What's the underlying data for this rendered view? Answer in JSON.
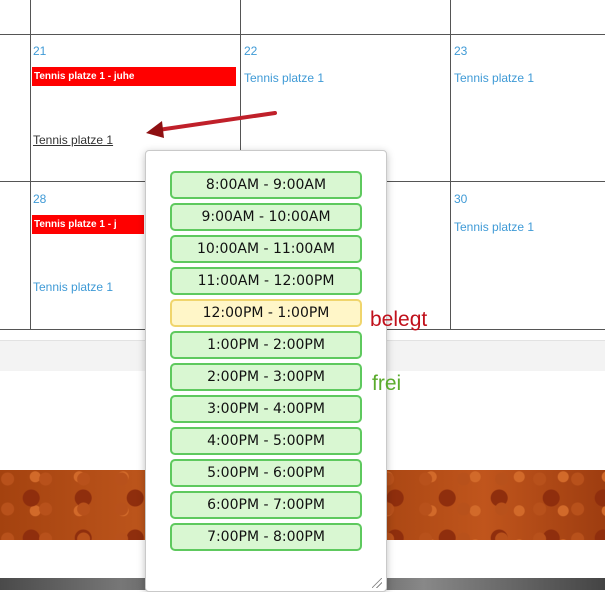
{
  "calendar": {
    "week1": {
      "day21": {
        "number": "21",
        "event_red": "Tennis platze 1 - juhe",
        "event_link": "Tennis platze 1"
      },
      "day22": {
        "number": "22",
        "event_link": "Tennis platze 1"
      },
      "day23": {
        "number": "23",
        "event_link": "Tennis platze 1"
      }
    },
    "week2": {
      "day28": {
        "number": "28",
        "event_red": "Tennis platze 1 - j",
        "event_link": "Tennis platze 1"
      },
      "day30": {
        "number": "30",
        "event_link": "Tennis platze 1"
      }
    }
  },
  "popup": {
    "slots": [
      {
        "label": "8:00AM - 9:00AM",
        "status": "free"
      },
      {
        "label": "9:00AM - 10:00AM",
        "status": "free"
      },
      {
        "label": "10:00AM - 11:00AM",
        "status": "free"
      },
      {
        "label": "11:00AM - 12:00PM",
        "status": "free"
      },
      {
        "label": "12:00PM - 1:00PM",
        "status": "busy"
      },
      {
        "label": "1:00PM - 2:00PM",
        "status": "free"
      },
      {
        "label": "2:00PM - 3:00PM",
        "status": "free"
      },
      {
        "label": "3:00PM - 4:00PM",
        "status": "free"
      },
      {
        "label": "4:00PM - 5:00PM",
        "status": "free"
      },
      {
        "label": "5:00PM - 6:00PM",
        "status": "free"
      },
      {
        "label": "6:00PM - 7:00PM",
        "status": "free"
      },
      {
        "label": "7:00PM - 8:00PM",
        "status": "free"
      }
    ]
  },
  "legend": {
    "busy": "belegt",
    "free": "frei"
  },
  "colors": {
    "free_bg": "#d9f7d2",
    "free_border": "#5ec95e",
    "busy_bg": "#fff6c8",
    "busy_border": "#f0d56c",
    "event_red": "#ff0000",
    "link_blue": "#3f9ad6",
    "legend_busy": "#c0101b",
    "legend_free": "#5aab2c"
  }
}
